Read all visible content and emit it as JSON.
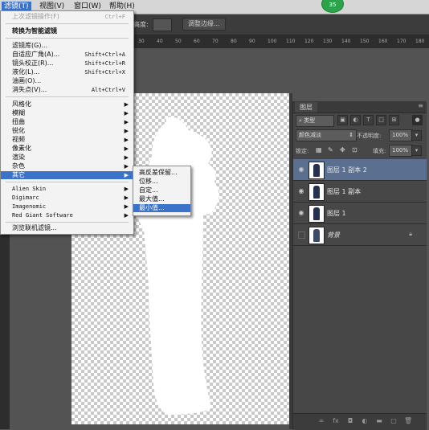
{
  "menubar": {
    "items": [
      {
        "label": "滤镜(T)"
      },
      {
        "label": "视图(V)"
      },
      {
        "label": "窗口(W)"
      },
      {
        "label": "帮助(H)"
      }
    ],
    "badge": "35"
  },
  "options_bar": {
    "height_label": "高度:",
    "refine_edge": "调整边缘..."
  },
  "ruler": {
    "ticks": [
      "30",
      "40",
      "50",
      "60",
      "70",
      "80",
      "90",
      "100",
      "110",
      "120",
      "130",
      "140",
      "150",
      "160",
      "170",
      "180"
    ]
  },
  "filter_menu": {
    "items": [
      {
        "label": "上次滤镜操作(F)",
        "shortcut": "Ctrl+F"
      },
      {
        "label": "转换为智能滤镜"
      },
      {
        "label": "滤镜库(G)..."
      },
      {
        "label": "自适应广角(A)...",
        "shortcut": "Shift+Ctrl+A"
      },
      {
        "label": "镜头校正(R)...",
        "shortcut": "Shift+Ctrl+R"
      },
      {
        "label": "液化(L)...",
        "shortcut": "Shift+Ctrl+X"
      },
      {
        "label": "油画(O)..."
      },
      {
        "label": "消失点(V)...",
        "shortcut": "Alt+Ctrl+V"
      },
      {
        "label": "风格化"
      },
      {
        "label": "模糊"
      },
      {
        "label": "扭曲"
      },
      {
        "label": "锐化"
      },
      {
        "label": "视频"
      },
      {
        "label": "像素化"
      },
      {
        "label": "渲染"
      },
      {
        "label": "杂色"
      },
      {
        "label": "其它"
      },
      {
        "label": "Alien Skin"
      },
      {
        "label": "Digimarc"
      },
      {
        "label": "Imagenomic"
      },
      {
        "label": "Red Giant Software"
      },
      {
        "label": "浏览联机滤镜..."
      }
    ]
  },
  "submenu": {
    "items": [
      {
        "label": "高反差保留..."
      },
      {
        "label": "位移..."
      },
      {
        "label": "自定..."
      },
      {
        "label": "最大值..."
      },
      {
        "label": "最小值..."
      }
    ]
  },
  "layers_panel": {
    "tab": "图层",
    "filter_kind": "类型",
    "blend_mode": "颜色减淡",
    "opacity_label": "不透明度:",
    "opacity_value": "100%",
    "lock_label": "锁定:",
    "fill_label": "填充:",
    "fill_value": "100%",
    "layers": [
      {
        "name": "图层 1 副本 2"
      },
      {
        "name": "图层 1 副本"
      },
      {
        "name": "图层 1"
      },
      {
        "name": "背景"
      }
    ]
  },
  "colors": {
    "accent": "#3b73c9",
    "selected_layer": "#5b6f91",
    "badge": "#2aa34a"
  }
}
